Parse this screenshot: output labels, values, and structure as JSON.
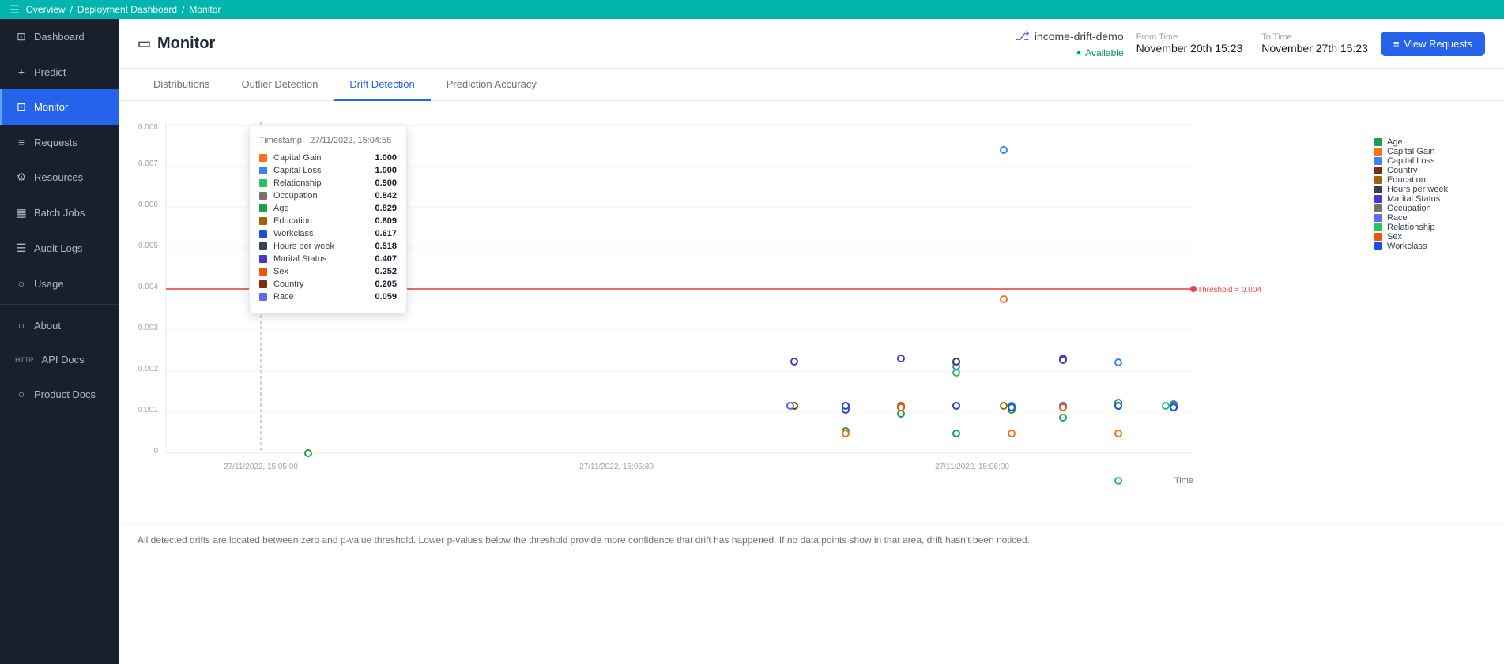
{
  "topbar": {
    "breadcrumb": [
      "Overview",
      "Deployment Dashboard",
      "Monitor"
    ]
  },
  "sidebar": {
    "items": [
      {
        "id": "dashboard",
        "label": "Dashboard",
        "icon": "⊡"
      },
      {
        "id": "predict",
        "label": "Predict",
        "icon": "+"
      },
      {
        "id": "monitor",
        "label": "Monitor",
        "icon": "⊡",
        "active": true
      },
      {
        "id": "requests",
        "label": "Requests",
        "icon": "≡"
      },
      {
        "id": "resources",
        "label": "Resources",
        "icon": "⚙"
      },
      {
        "id": "batch-jobs",
        "label": "Batch Jobs",
        "icon": "▦"
      },
      {
        "id": "audit-logs",
        "label": "Audit Logs",
        "icon": "☰"
      },
      {
        "id": "usage",
        "label": "Usage",
        "icon": "○"
      },
      {
        "id": "about",
        "label": "About",
        "icon": "○"
      },
      {
        "id": "api-docs",
        "label": "API Docs",
        "icon": ""
      },
      {
        "id": "product-docs",
        "label": "Product Docs",
        "icon": "○"
      }
    ]
  },
  "header": {
    "title": "Monitor",
    "deployment_name": "income-drift-demo",
    "status": "Available",
    "from_time_label": "From Time",
    "from_time_value": "November 20th 15:23",
    "to_time_label": "To Time",
    "to_time_value": "November 27th 15:23",
    "view_requests_label": "View Requests"
  },
  "tabs": [
    {
      "id": "distributions",
      "label": "Distributions",
      "active": false
    },
    {
      "id": "outlier-detection",
      "label": "Outlier Detection",
      "active": false
    },
    {
      "id": "drift-detection",
      "label": "Drift Detection",
      "active": true
    },
    {
      "id": "prediction-accuracy",
      "label": "Prediction Accuracy",
      "active": false
    }
  ],
  "chart": {
    "y_labels": [
      "0",
      "0.001",
      "0.002",
      "0.003",
      "0.004",
      "0.005",
      "0.006",
      "0.007",
      "0.008"
    ],
    "x_labels": [
      "27/11/2022, 15:05:00",
      "27/11/2022, 15:05:30",
      "27/11/2022, 15:06:00"
    ],
    "time_label": "Time",
    "threshold_label": "Threshold = 0.004"
  },
  "tooltip": {
    "timestamp_label": "Timestamp:",
    "timestamp_value": "27/11/2022, 15:04:55",
    "items": [
      {
        "name": "Capital Gain",
        "value": "1.000",
        "color": "#f97316"
      },
      {
        "name": "Capital Loss",
        "value": "1.000",
        "color": "#3b82f6"
      },
      {
        "name": "Relationship",
        "value": "0.900",
        "color": "#22c55e"
      },
      {
        "name": "Occupation",
        "value": "0.842",
        "color": "#78716c"
      },
      {
        "name": "Age",
        "value": "0.829",
        "color": "#16a34a"
      },
      {
        "name": "Education",
        "value": "0.809",
        "color": "#a16207"
      },
      {
        "name": "Workclass",
        "value": "0.617",
        "color": "#1d4ed8"
      },
      {
        "name": "Hours per week",
        "value": "0.518",
        "color": "#374151"
      },
      {
        "name": "Marital Status",
        "value": "0.407",
        "color": "#4338ca"
      },
      {
        "name": "Sex",
        "value": "0.252",
        "color": "#ea580c"
      },
      {
        "name": "Country",
        "value": "0.205",
        "color": "#7c2d12"
      },
      {
        "name": "Race",
        "value": "0.059",
        "color": "#6366f1"
      }
    ]
  },
  "legend": {
    "items": [
      {
        "label": "Age",
        "color": "#16a34a"
      },
      {
        "label": "Capital Gain",
        "color": "#f97316"
      },
      {
        "label": "Capital Loss",
        "color": "#3b82f6"
      },
      {
        "label": "Country",
        "color": "#7c2d12"
      },
      {
        "label": "Education",
        "color": "#a16207"
      },
      {
        "label": "Hours per week",
        "color": "#374151"
      },
      {
        "label": "Marital Status",
        "color": "#4338ca"
      },
      {
        "label": "Occupation",
        "color": "#78716c"
      },
      {
        "label": "Race",
        "color": "#6366f1"
      },
      {
        "label": "Relationship",
        "color": "#22c55e"
      },
      {
        "label": "Sex",
        "color": "#ea580c"
      },
      {
        "label": "Workclass",
        "color": "#1d4ed8"
      }
    ]
  },
  "footer": {
    "text": "All detected drifts are located between zero and p-value threshold. Lower p-values below the threshold provide more confidence that drift has happened. If no data points show in that area, drift hasn't been noticed."
  }
}
